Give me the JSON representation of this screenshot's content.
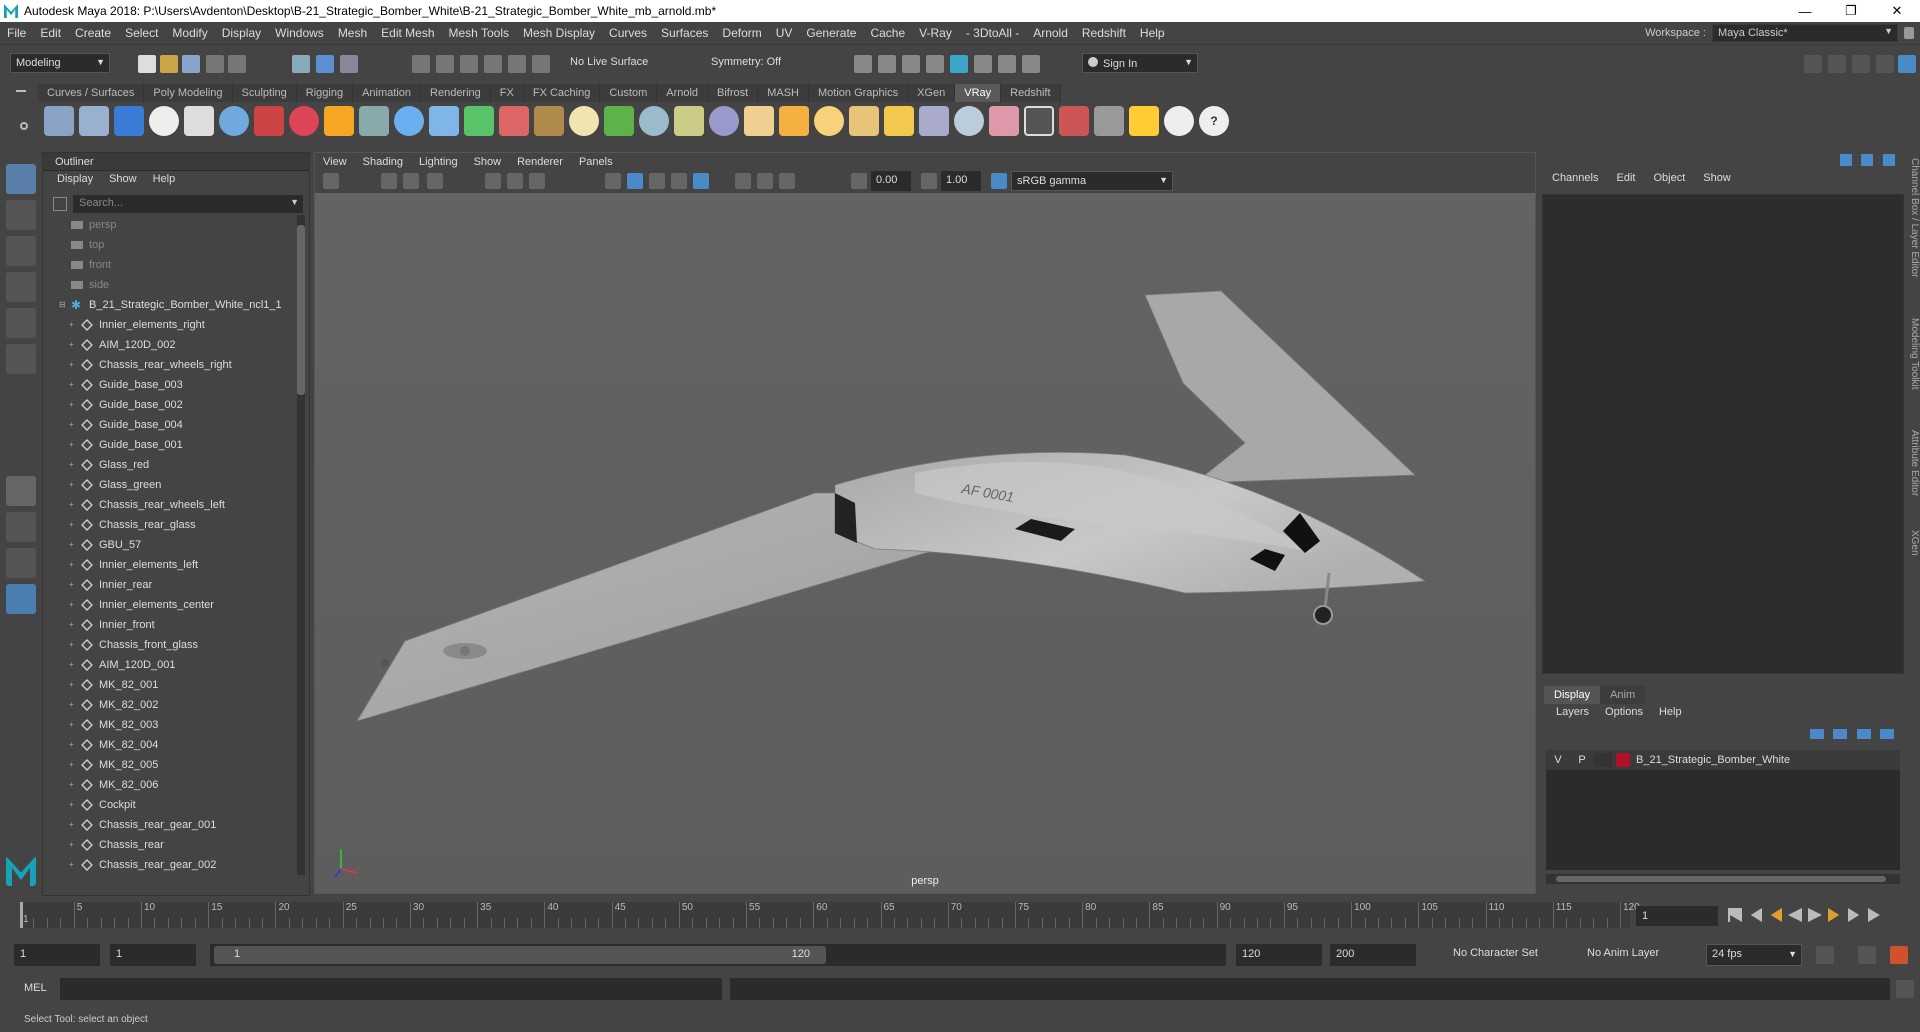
{
  "window": {
    "title": "Autodesk Maya 2018: P:\\Users\\Avdenton\\Desktop\\B-21_Strategic_Bomber_White\\B-21_Strategic_Bomber_White_mb_arnold.mb*",
    "minimize": "—",
    "maximize": "❐",
    "close": "✕"
  },
  "menu": {
    "items": [
      "File",
      "Edit",
      "Create",
      "Select",
      "Modify",
      "Display",
      "Windows",
      "Mesh",
      "Edit Mesh",
      "Mesh Tools",
      "Mesh Display",
      "Curves",
      "Surfaces",
      "Deform",
      "UV",
      "Generate",
      "Cache",
      "V-Ray",
      "- 3DtoAll -",
      "Arnold",
      "Redshift",
      "Help"
    ],
    "workspace_label": "Workspace :",
    "workspace_value": "Maya Classic*"
  },
  "status": {
    "mode": "Modeling",
    "live_surface": "No Live Surface",
    "symmetry": "Symmetry: Off",
    "sign_in": "Sign In"
  },
  "shelf": {
    "tabs": [
      "Curves / Surfaces",
      "Poly Modeling",
      "Sculpting",
      "Rigging",
      "Animation",
      "Rendering",
      "FX",
      "FX Caching",
      "Custom",
      "Arnold",
      "Bifrost",
      "MASH",
      "Motion Graphics",
      "XGen",
      "VRay",
      "Redshift"
    ],
    "active": "VRay"
  },
  "outliner": {
    "title": "Outliner",
    "menu": [
      "Display",
      "Show",
      "Help"
    ],
    "search_placeholder": "Search...",
    "cameras": [
      "persp",
      "top",
      "front",
      "side"
    ],
    "group": "B_21_Strategic_Bomber_White_ncl1_1",
    "items": [
      "Innier_elements_right",
      "AIM_120D_002",
      "Chassis_rear_wheels_right",
      "Guide_base_003",
      "Guide_base_002",
      "Guide_base_004",
      "Guide_base_001",
      "Glass_red",
      "Glass_green",
      "Chassis_rear_wheels_left",
      "Chassis_rear_glass",
      "GBU_57",
      "Innier_elements_left",
      "Innier_rear",
      "Innier_elements_center",
      "Innier_front",
      "Chassis_front_glass",
      "AIM_120D_001",
      "MK_82_001",
      "MK_82_002",
      "MK_82_003",
      "MK_82_004",
      "MK_82_005",
      "MK_82_006",
      "Cockpit",
      "Chassis_rear_gear_001",
      "Chassis_rear",
      "Chassis_rear_gear_002"
    ]
  },
  "viewport": {
    "menu": [
      "View",
      "Shading",
      "Lighting",
      "Show",
      "Renderer",
      "Panels"
    ],
    "exposure": "0.00",
    "gamma": "1.00",
    "colorspace": "sRGB gamma",
    "camera_label": "persp",
    "decals": {
      "tail": "AF 0001"
    }
  },
  "channelbox": {
    "menu": [
      "Channels",
      "Edit",
      "Object",
      "Show"
    ]
  },
  "layers": {
    "tabs": [
      "Display",
      "Anim"
    ],
    "menu": [
      "Layers",
      "Options",
      "Help"
    ],
    "row": {
      "v": "V",
      "p": "P",
      "name": "B_21_Strategic_Bomber_White",
      "color": "#b0102a"
    }
  },
  "sidetabs": [
    "Channel Box / Layer Editor",
    "Modeling Toolkit",
    "Attribute Editor",
    "XGen"
  ],
  "timeline": {
    "ticks": [
      "1",
      "5",
      "10",
      "15",
      "20",
      "25",
      "30",
      "35",
      "40",
      "45",
      "50",
      "55",
      "60",
      "65",
      "70",
      "75",
      "80",
      "85",
      "90",
      "95",
      "100",
      "105",
      "110",
      "115",
      "120"
    ],
    "current": "1"
  },
  "range": {
    "start": "1",
    "anim_start": "1",
    "slider_start": "1",
    "slider_end": "120",
    "end": "120",
    "anim_end": "200",
    "character_set": "No Character Set",
    "anim_layer": "No Anim Layer",
    "fps": "24 fps"
  },
  "cmd": {
    "label": "MEL"
  },
  "help": {
    "text": "Select Tool: select an object"
  }
}
